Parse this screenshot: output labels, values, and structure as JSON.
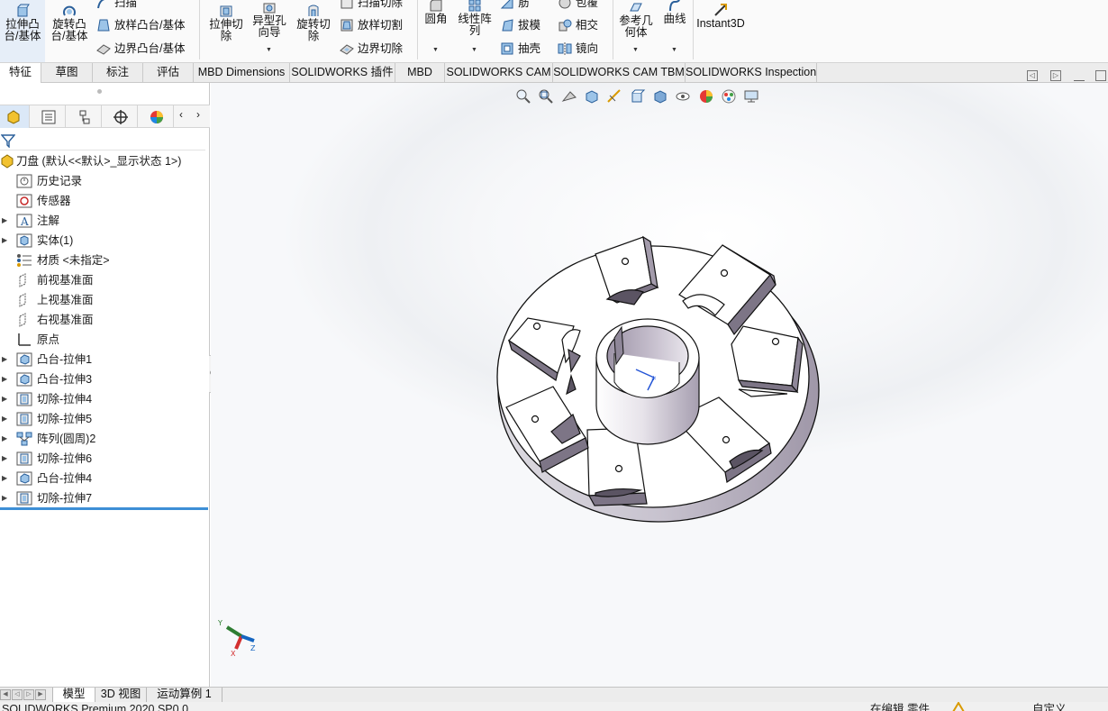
{
  "ribbon": {
    "extrude_boss": "拉伸凸台/基体",
    "revolve_boss": "旋转凸台/基体",
    "sweep": "扫描",
    "loft_boss": "放样凸台/基体",
    "boundary_boss": "边界凸台/基体",
    "extrude_cut": "拉伸切除",
    "hole_wizard": "异型孔向导",
    "revolve_cut": "旋转切除",
    "sweep_cut": "扫描切除",
    "loft_cut": "放样切割",
    "boundary_cut": "边界切除",
    "fillet": "圆角",
    "linear_pattern": "线性阵列",
    "rib": "筋",
    "draft": "拔模",
    "shell": "抽壳",
    "wrap": "包覆",
    "intersect": "相交",
    "mirror": "镜向",
    "ref_geometry": "参考几何体",
    "curves": "曲线",
    "instant3d": "Instant3D"
  },
  "command_tabs": [
    "特征",
    "草图",
    "标注",
    "评估",
    "MBD Dimensions",
    "SOLIDWORKS 插件",
    "MBD",
    "SOLIDWORKS CAM",
    "SOLIDWORKS CAM TBM",
    "SOLIDWORKS Inspection"
  ],
  "tree": {
    "root": "刀盘  (默认<<默认>_显示状态 1>)",
    "items": [
      {
        "label": "历史记录",
        "icon": "history-icon",
        "expandable": false
      },
      {
        "label": "传感器",
        "icon": "sensor-icon",
        "expandable": false
      },
      {
        "label": "注解",
        "icon": "annotation-icon",
        "expandable": true
      },
      {
        "label": "实体(1)",
        "icon": "solid-bodies-icon",
        "expandable": true
      },
      {
        "label": "材质 <未指定>",
        "icon": "material-icon",
        "expandable": false
      },
      {
        "label": "前视基准面",
        "icon": "plane-icon",
        "expandable": false
      },
      {
        "label": "上视基准面",
        "icon": "plane-icon",
        "expandable": false
      },
      {
        "label": "右视基准面",
        "icon": "plane-icon",
        "expandable": false
      },
      {
        "label": "原点",
        "icon": "origin-icon",
        "expandable": false
      },
      {
        "label": "凸台-拉伸1",
        "icon": "boss-extrude-icon",
        "expandable": true
      },
      {
        "label": "凸台-拉伸3",
        "icon": "boss-extrude-icon",
        "expandable": true
      },
      {
        "label": "切除-拉伸4",
        "icon": "cut-extrude-icon",
        "expandable": true
      },
      {
        "label": "切除-拉伸5",
        "icon": "cut-extrude-icon",
        "expandable": true
      },
      {
        "label": "阵列(圆周)2",
        "icon": "circular-pattern-icon",
        "expandable": true
      },
      {
        "label": "切除-拉伸6",
        "icon": "cut-extrude-icon",
        "expandable": true
      },
      {
        "label": "凸台-拉伸4",
        "icon": "boss-extrude-icon",
        "expandable": true
      },
      {
        "label": "切除-拉伸7",
        "icon": "cut-extrude-icon",
        "expandable": true
      }
    ]
  },
  "triad": {
    "x": "X",
    "y": "Y",
    "z": "Z"
  },
  "bottom_tabs": [
    "模型",
    "3D 视图",
    "运动算例 1"
  ],
  "status": {
    "product": "SOLIDWORKS Premium 2020 SP0.0",
    "mode": "在编辑 零件",
    "units": "自定义"
  },
  "colors": {
    "accent": "#3d8fd6",
    "tab_active": "#ffffff",
    "model_face": "#ffffff",
    "model_shade": "#b9b3c2"
  }
}
